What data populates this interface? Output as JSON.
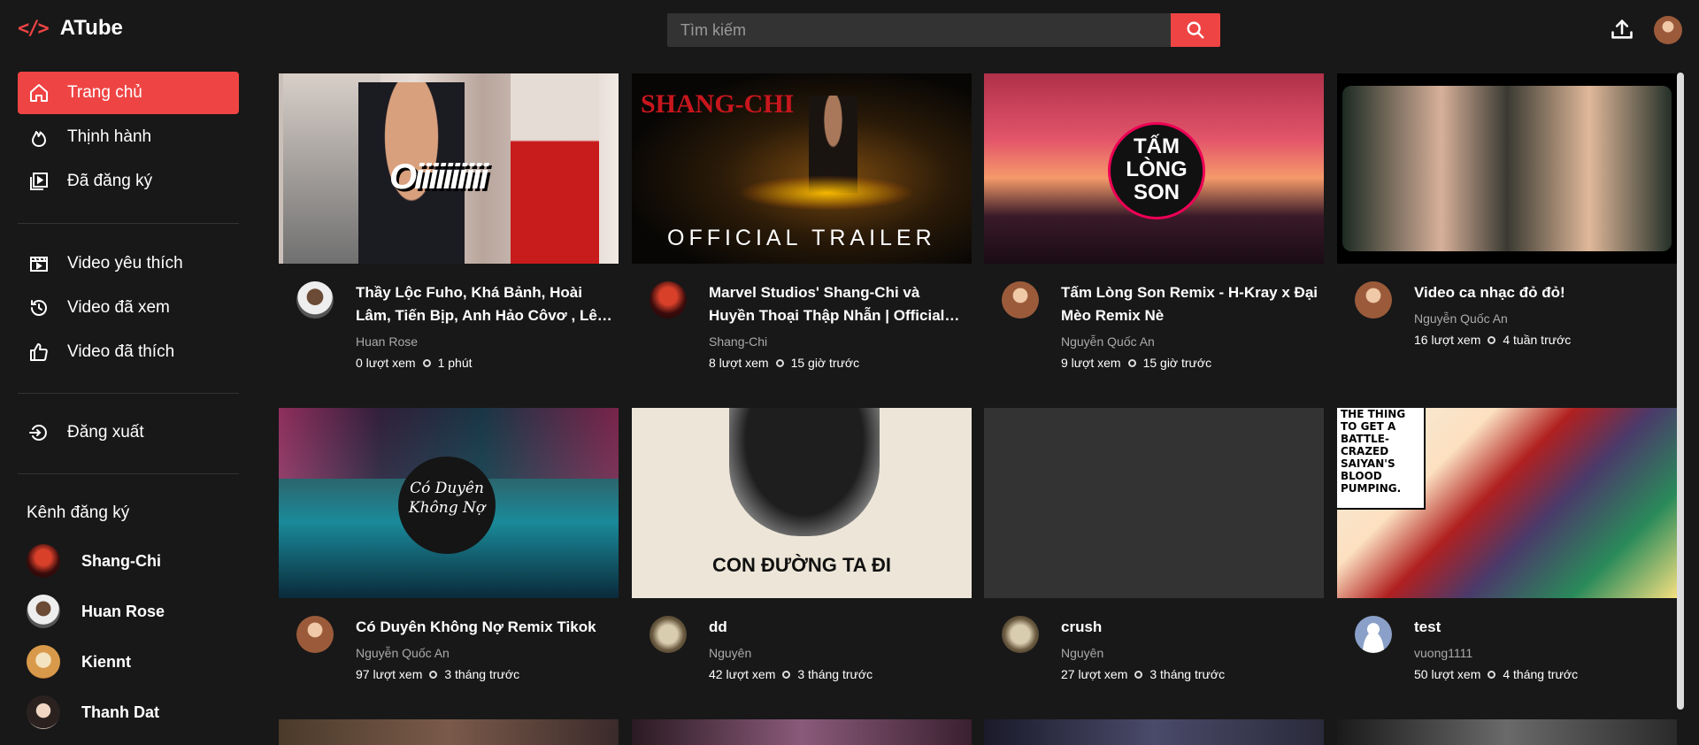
{
  "header": {
    "logo_icon": "</>",
    "app_name": "ATube",
    "search_placeholder": "Tìm kiếm"
  },
  "sidebar": {
    "nav": [
      {
        "label": "Trang chủ",
        "icon": "home-icon",
        "active": true
      },
      {
        "label": "Thịnh hành",
        "icon": "fire-icon"
      },
      {
        "label": "Đã đăng ký",
        "icon": "subscriptions-icon"
      },
      {
        "label": "Video yêu thích",
        "icon": "favorite-video-icon"
      },
      {
        "label": "Video đã xem",
        "icon": "history-icon"
      },
      {
        "label": "Video đã thích",
        "icon": "thumbs-up-icon"
      },
      {
        "label": "Đăng xuất",
        "icon": "logout-icon"
      }
    ],
    "subscriptions_title": "Kênh đăng ký",
    "channels": [
      {
        "name": "Shang-Chi"
      },
      {
        "name": "Huan Rose"
      },
      {
        "name": "Kiennt"
      },
      {
        "name": "Thanh Dat"
      }
    ]
  },
  "videos": [
    {
      "title": "Thầy Lộc Fuho, Khá Bảnh, Hoài Lâm, Tiến Bịp, Anh Hảo Côvơ , Lê Hảo, Khả...",
      "channel": "Huan Rose",
      "views": "0 lượt xem",
      "time": "1 phút",
      "thumb_text": "Oiiiiiiiiii"
    },
    {
      "title": "Marvel Studios' Shang-Chi và Huyền Thoại Thập Nhẫn | Official Trailer",
      "channel": "Shang-Chi",
      "views": "8 lượt xem",
      "time": "15 giờ trước",
      "thumb_text": "OFFICIAL TRAILER"
    },
    {
      "title": "Tấm Lòng Son Remix - H-Kray x Đại Mèo Remix Nè",
      "channel": "Nguyễn Quốc An",
      "views": "9 lượt xem",
      "time": "15 giờ trước",
      "thumb_text": "TẤM LÒNG SON"
    },
    {
      "title": "Video ca nhạc đỏ đỏ!",
      "channel": "Nguyễn Quốc An",
      "views": "16 lượt xem",
      "time": "4 tuần trước",
      "thumb_text": ""
    },
    {
      "title": "Có Duyên Không Nợ Remix Tikok",
      "channel": "Nguyễn Quốc An",
      "views": "97 lượt xem",
      "time": "3 tháng trước",
      "thumb_text": "Có Duyên Không Nợ"
    },
    {
      "title": "dd",
      "channel": "Nguyên",
      "views": "42 lượt xem",
      "time": "3 tháng trước",
      "thumb_text": "CON ĐƯỜNG TA ĐI"
    },
    {
      "title": "crush",
      "channel": "Nguyên",
      "views": "27 lượt xem",
      "time": "3 tháng trước",
      "thumb_text": ""
    },
    {
      "title": "test",
      "channel": "vuong1111",
      "views": "50 lượt xem",
      "time": "4 tháng trước",
      "thumb_text": "THE THING TO GET A BATTLE-CRAZED SAIYAN'S BLOOD PUMPING."
    }
  ]
}
